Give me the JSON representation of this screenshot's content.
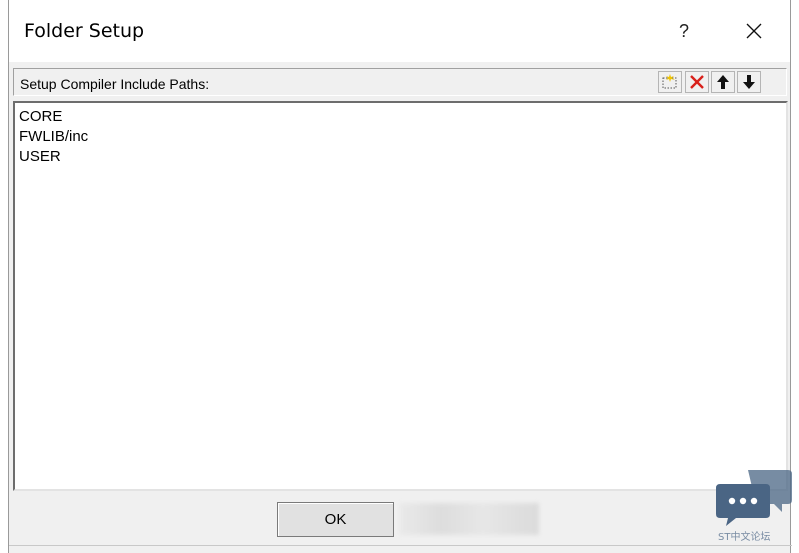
{
  "window": {
    "title": "Folder Setup",
    "help_label": "?",
    "close_icon": "close-icon"
  },
  "header": {
    "label": "Setup Compiler Include Paths:",
    "toolbar": [
      {
        "icon": "new-folder-icon"
      },
      {
        "icon": "delete-icon",
        "color": "#d8201a"
      },
      {
        "icon": "move-up-icon"
      },
      {
        "icon": "move-down-icon"
      }
    ]
  },
  "paths": [
    "CORE",
    "FWLIB/inc",
    "USER"
  ],
  "buttons": {
    "ok_label": "OK"
  },
  "watermark": {
    "text": "ST中文论坛",
    "icon": "chat-bubble-icon",
    "color": "#4a6584"
  }
}
